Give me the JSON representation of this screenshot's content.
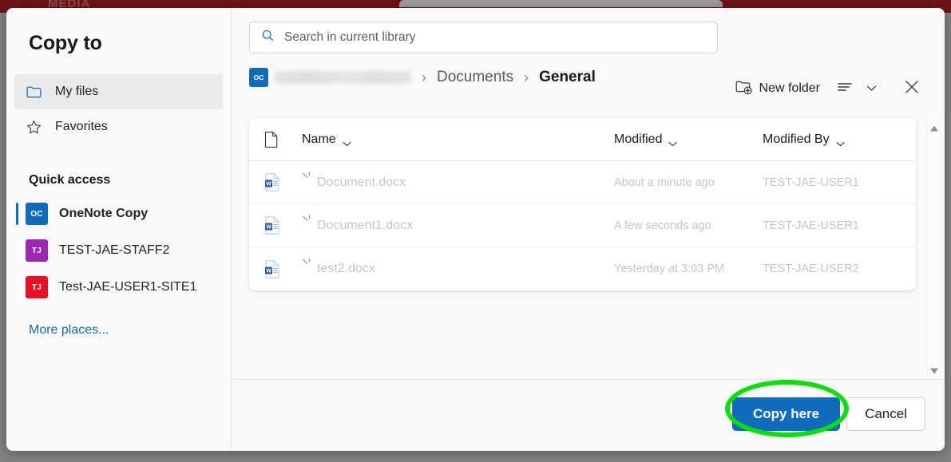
{
  "background": {
    "watermark_text": "MEDIA",
    "maroon_color": "#6e1418"
  },
  "dialog": {
    "title": "Copy to"
  },
  "sidebar": {
    "nav_items": [
      {
        "label": "My files",
        "icon": "folder-icon",
        "selected": true
      },
      {
        "label": "Favorites",
        "icon": "star-icon",
        "selected": false
      }
    ],
    "quick_access_title": "Quick access",
    "quick_access": [
      {
        "label": "OneNote Copy",
        "initials": "OC",
        "color": "#0f6cbd",
        "selected": true
      },
      {
        "label": "TEST-JAE-STAFF2",
        "initials": "TJ",
        "color": "#9c27b0",
        "selected": false
      },
      {
        "label": "Test-JAE-USER1-SITE1",
        "initials": "TJ",
        "color": "#e81123",
        "selected": false
      }
    ],
    "more_places_label": "More places..."
  },
  "search": {
    "placeholder": "Search in current library",
    "icon": "search-icon",
    "value": ""
  },
  "breadcrumb": {
    "site_initials": "OC",
    "site_redacted": true,
    "separator": "›",
    "items": [
      {
        "label": "Documents",
        "current": false
      },
      {
        "label": "General",
        "current": true
      }
    ]
  },
  "toolbar": {
    "new_folder_label": "New folder",
    "new_folder_icon": "new-folder-icon",
    "view_options_icon": "list-view-icon",
    "view_chevron_icon": "chevron-down-icon",
    "close_icon": "close-icon"
  },
  "file_list": {
    "columns": [
      {
        "label": "",
        "icon": "file-type-icon"
      },
      {
        "label": "Name",
        "sortable": true
      },
      {
        "label": "Modified",
        "sortable": true
      },
      {
        "label": "Modified By",
        "sortable": true
      }
    ],
    "rows": [
      {
        "icon": "word-doc-icon",
        "name": "Document.docx",
        "modified": "About a minute ago",
        "modified_by": "TEST-JAE-USER1"
      },
      {
        "icon": "word-doc-icon",
        "name": "Document1.docx",
        "modified": "A few seconds ago",
        "modified_by": "TEST-JAE-USER1"
      },
      {
        "icon": "word-doc-icon",
        "name": "test2.docx",
        "modified": "Yesterday at 3:03 PM",
        "modified_by": "TEST-JAE-USER2"
      }
    ]
  },
  "scrollbar": {
    "up_icon": "scroll-up-arrow-icon",
    "down_icon": "scroll-down-arrow-icon"
  },
  "footer": {
    "primary_label": "Copy here",
    "secondary_label": "Cancel"
  },
  "annotation": {
    "shape": "ellipse",
    "color": "#09e009",
    "target": "Copy here"
  }
}
